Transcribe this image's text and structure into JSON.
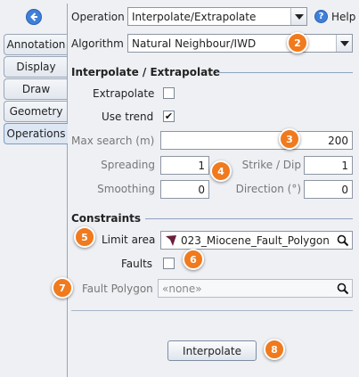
{
  "tabs": [
    {
      "label": "Annotation"
    },
    {
      "label": "Display"
    },
    {
      "label": "Draw"
    },
    {
      "label": "Geometry"
    },
    {
      "label": "Operations"
    }
  ],
  "operation": {
    "label": "Operation",
    "value": "Interpolate/Extrapolate"
  },
  "help": {
    "label": "Help"
  },
  "algorithm": {
    "label": "Algorithm",
    "value": "Natural Neighbour/IWD"
  },
  "interp_section": {
    "title": "Interpolate / Extrapolate"
  },
  "extrapolate": {
    "label": "Extrapolate",
    "checked": false
  },
  "use_trend": {
    "label": "Use trend",
    "checked": true,
    "mark": "✔"
  },
  "max_search": {
    "label": "Max search (m)",
    "value": "200"
  },
  "spreading": {
    "label": "Spreading",
    "value": "1"
  },
  "strike_dip": {
    "label": "Strike / Dip",
    "value": "1"
  },
  "smoothing": {
    "label": "Smoothing",
    "value": "0"
  },
  "direction": {
    "label": "Direction (°)",
    "value": "0"
  },
  "constraints": {
    "title": "Constraints"
  },
  "limit_area": {
    "label": "Limit area",
    "value": "023_Miocene_Fault_Polygon"
  },
  "faults": {
    "label": "Faults",
    "checked": false
  },
  "fault_polygon": {
    "label": "Fault Polygon",
    "value": "«none»"
  },
  "interpolate_button": {
    "label": "Interpolate"
  },
  "badges": [
    "2",
    "3",
    "4",
    "5",
    "6",
    "7",
    "8"
  ],
  "colors": {
    "badge": "#f07a1d",
    "accent": "#3f7fd8",
    "polygon_icon": "#6b1f3a"
  }
}
